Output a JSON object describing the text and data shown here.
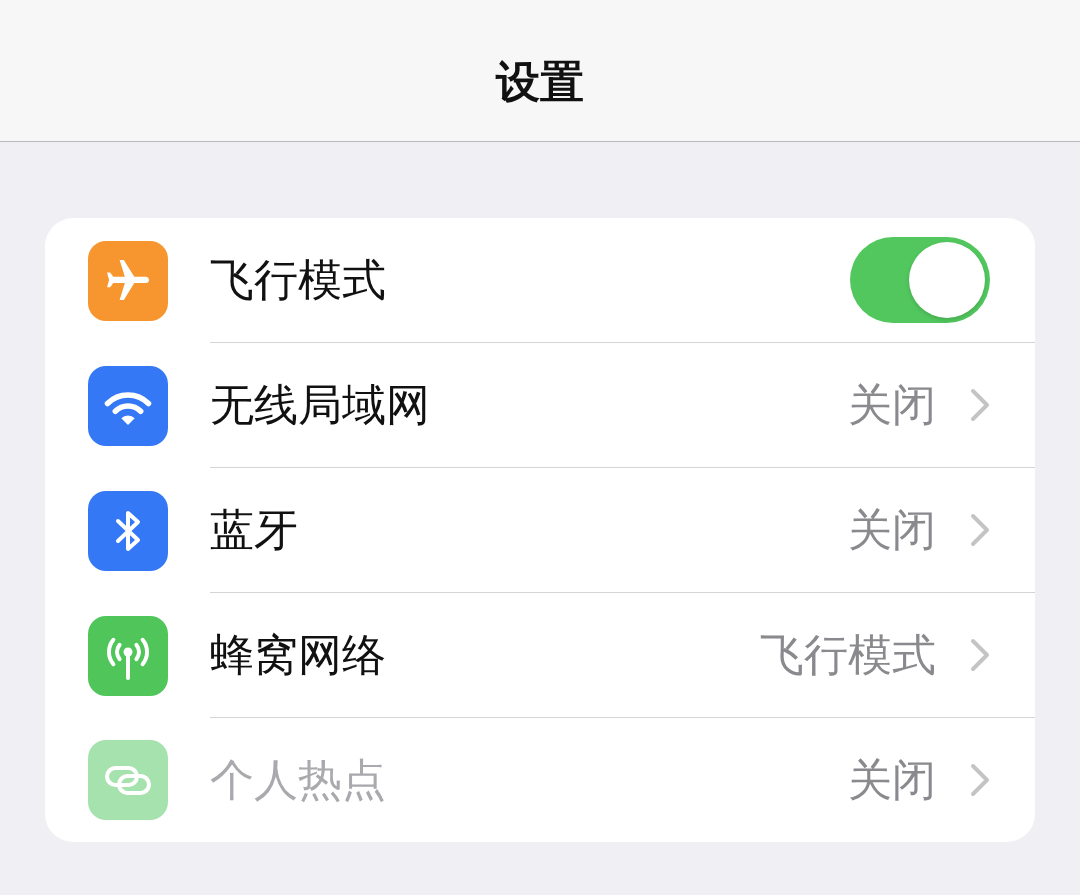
{
  "navigation_bar": {
    "title": "设置"
  },
  "settings": [
    {
      "kind": "toggle",
      "label": "飞行模式",
      "color": "#f7962f",
      "on": true,
      "disabled": false
    },
    {
      "kind": "link",
      "label": "无线局域网",
      "color": "#3478f6",
      "value": "关闭",
      "disabled": false
    },
    {
      "kind": "link",
      "label": "蓝牙",
      "color": "#3478f6",
      "value": "关闭",
      "disabled": false
    },
    {
      "kind": "link",
      "label": "蜂窝网络",
      "color": "#4fc55a",
      "value": "飞行模式",
      "disabled": false
    },
    {
      "kind": "link",
      "label": "个人热点",
      "color": "#a6e2ae",
      "value": "关闭",
      "disabled": true
    }
  ]
}
